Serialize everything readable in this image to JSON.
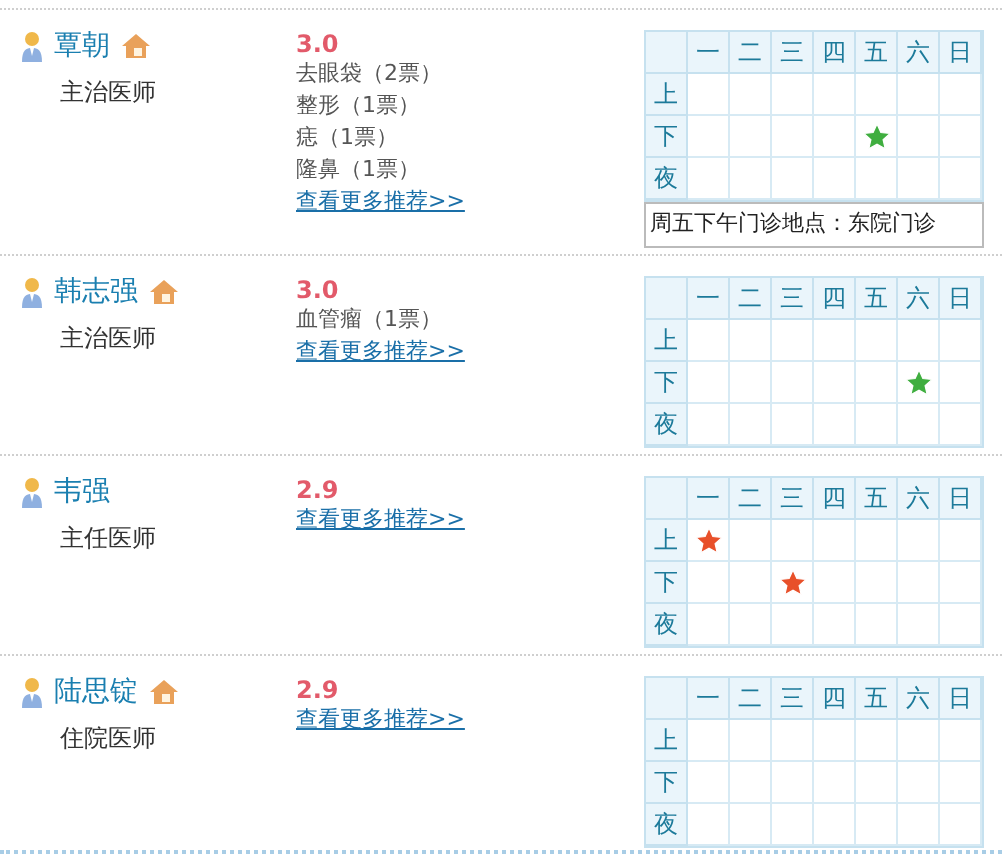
{
  "doctors": [
    {
      "name": "覃朝",
      "home": true,
      "title": "主治医师",
      "score": "3.0",
      "votes": [
        "去眼袋（2票）",
        "整形（1票）",
        "痣（1票）",
        "隆鼻（1票）"
      ],
      "more": "查看更多推荐>>",
      "schedule": {
        "days": [
          "一",
          "二",
          "三",
          "四",
          "五",
          "六",
          "日"
        ],
        "rows": [
          {
            "label": "上",
            "cells": [
              {
                "star": false
              },
              {
                "star": false
              },
              {
                "star": false
              },
              {
                "star": false
              },
              {
                "star": false
              },
              {
                "star": false
              },
              {
                "star": false
              }
            ]
          },
          {
            "label": "下",
            "cells": [
              {
                "star": false
              },
              {
                "star": false
              },
              {
                "star": false
              },
              {
                "star": false
              },
              {
                "star": true,
                "color": "#3fae3f"
              },
              {
                "star": false
              },
              {
                "star": false
              }
            ]
          },
          {
            "label": "夜",
            "cells": [
              {
                "star": false
              },
              {
                "star": false
              },
              {
                "star": false
              },
              {
                "star": false
              },
              {
                "star": false
              },
              {
                "star": false
              },
              {
                "star": false
              }
            ]
          }
        ]
      },
      "tooltip": "周五下午门诊地点：东院门诊"
    },
    {
      "name": "韩志强",
      "home": true,
      "title": "主治医师",
      "score": "3.0",
      "votes": [
        "血管瘤（1票）"
      ],
      "more": "查看更多推荐>>",
      "schedule": {
        "days": [
          "一",
          "二",
          "三",
          "四",
          "五",
          "六",
          "日"
        ],
        "rows": [
          {
            "label": "上",
            "cells": [
              {
                "star": false
              },
              {
                "star": false
              },
              {
                "star": false
              },
              {
                "star": false
              },
              {
                "star": false
              },
              {
                "star": false
              },
              {
                "star": false
              }
            ]
          },
          {
            "label": "下",
            "cells": [
              {
                "star": false
              },
              {
                "star": false
              },
              {
                "star": false
              },
              {
                "star": false
              },
              {
                "star": false
              },
              {
                "star": true,
                "color": "#3fae3f"
              },
              {
                "star": false
              }
            ]
          },
          {
            "label": "夜",
            "cells": [
              {
                "star": false
              },
              {
                "star": false
              },
              {
                "star": false
              },
              {
                "star": false
              },
              {
                "star": false
              },
              {
                "star": false
              },
              {
                "star": false
              }
            ]
          }
        ]
      }
    },
    {
      "name": "韦强",
      "home": false,
      "title": "主任医师",
      "score": "2.9",
      "more": "查看更多推荐>>",
      "schedule": {
        "days": [
          "一",
          "二",
          "三",
          "四",
          "五",
          "六",
          "日"
        ],
        "rows": [
          {
            "label": "上",
            "cells": [
              {
                "star": true,
                "color": "#e8502a"
              },
              {
                "star": false
              },
              {
                "star": false
              },
              {
                "star": false
              },
              {
                "star": false
              },
              {
                "star": false
              },
              {
                "star": false
              }
            ]
          },
          {
            "label": "下",
            "cells": [
              {
                "star": false
              },
              {
                "star": false
              },
              {
                "star": true,
                "color": "#e8502a"
              },
              {
                "star": false
              },
              {
                "star": false
              },
              {
                "star": false
              },
              {
                "star": false
              }
            ]
          },
          {
            "label": "夜",
            "cells": [
              {
                "star": false
              },
              {
                "star": false
              },
              {
                "star": false
              },
              {
                "star": false
              },
              {
                "star": false
              },
              {
                "star": false
              },
              {
                "star": false
              }
            ]
          }
        ]
      }
    },
    {
      "name": "陆思锭",
      "home": true,
      "title": "住院医师",
      "score": "2.9",
      "more": "查看更多推荐>>",
      "schedule": {
        "days": [
          "一",
          "二",
          "三",
          "四",
          "五",
          "六",
          "日"
        ],
        "rows": [
          {
            "label": "上",
            "cells": [
              {
                "star": false
              },
              {
                "star": false
              },
              {
                "star": false
              },
              {
                "star": false
              },
              {
                "star": false
              },
              {
                "star": false
              },
              {
                "star": false
              }
            ]
          },
          {
            "label": "下",
            "cells": [
              {
                "star": false
              },
              {
                "star": false
              },
              {
                "star": false
              },
              {
                "star": false
              },
              {
                "star": false
              },
              {
                "star": false
              },
              {
                "star": false
              }
            ]
          },
          {
            "label": "夜",
            "cells": [
              {
                "star": false
              },
              {
                "star": false
              },
              {
                "star": false
              },
              {
                "star": false
              },
              {
                "star": false
              },
              {
                "star": false
              },
              {
                "star": false
              }
            ]
          }
        ]
      }
    }
  ]
}
